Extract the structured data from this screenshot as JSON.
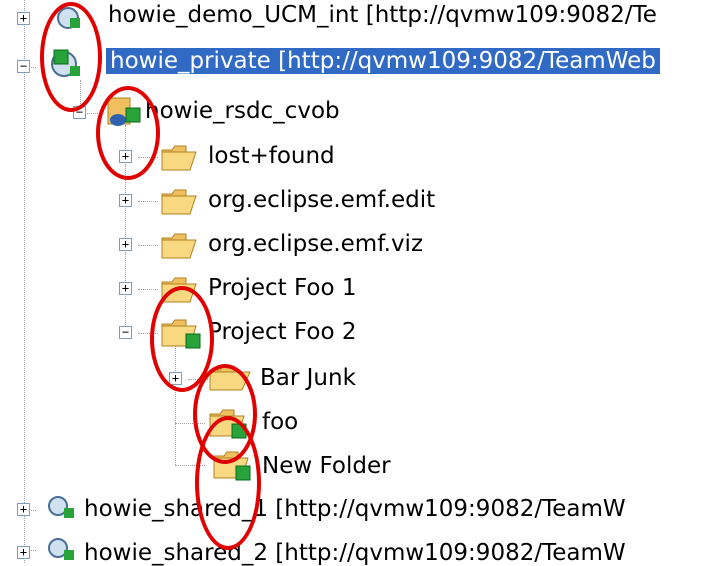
{
  "tree": {
    "items": [
      {
        "label": "howie_demo_UCM_int [http://qvmw109:9082/Te"
      },
      {
        "label": "howie_private [http://qvmw109:9082/TeamWeb"
      },
      {
        "label": "howie_rsdc_cvob"
      },
      {
        "label": "lost+found"
      },
      {
        "label": "org.eclipse.emf.edit"
      },
      {
        "label": "org.eclipse.emf.viz"
      },
      {
        "label": "Project Foo 1"
      },
      {
        "label": "Project Foo 2"
      },
      {
        "label": "Bar Junk"
      },
      {
        "label": "foo"
      },
      {
        "label": "New Folder"
      },
      {
        "label": "howie_shared_1 [http://qvmw109:9082/TeamW"
      },
      {
        "label": "howie_shared_2 [http://qvmw109:9082/TeamW"
      }
    ],
    "toggles": {
      "plus": "+",
      "minus": "−"
    },
    "badge_glyph": "✱"
  },
  "colors": {
    "selection": "#316ac5",
    "annotation": "#e00000",
    "folder": "#f0c060",
    "badge": "#27a33a"
  }
}
